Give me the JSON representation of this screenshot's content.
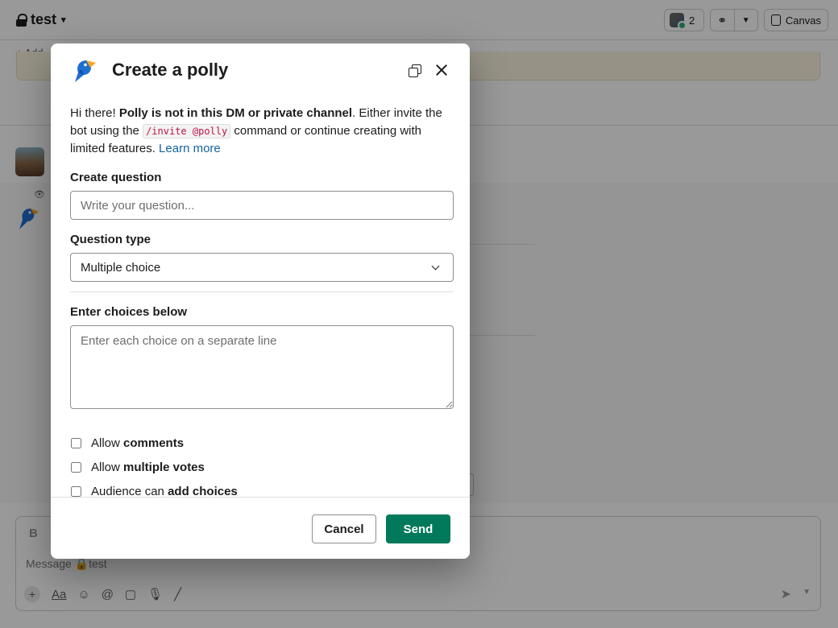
{
  "app": {
    "channel_name": "test",
    "member_count": "2",
    "canvas_label": "Canvas",
    "bookmark_label": "Add",
    "composer_placeholder": "Message 🔒test",
    "composer_bold_label": "B",
    "composer_format_label": "Aa"
  },
  "modal": {
    "title": "Create a polly",
    "intro": {
      "greeting": "Hi there! ",
      "bold_notice": "Polly is not in this DM or private channel",
      "text_before_command": ". Either invite the bot using the ",
      "command": "/invite @polly",
      "text_after_command": " command or continue creating with limited features. ",
      "link_label": "Learn more"
    },
    "question": {
      "label": "Create question",
      "placeholder": "Write your question..."
    },
    "question_type": {
      "label": "Question type",
      "selected": "Multiple choice"
    },
    "choices": {
      "label": "Enter choices below",
      "placeholder": "Enter each choice on a separate line"
    },
    "options": [
      {
        "prefix": "Allow ",
        "bold": "comments",
        "checked": false
      },
      {
        "prefix": "Allow ",
        "bold": "multiple votes",
        "checked": false
      },
      {
        "prefix": "Audience can ",
        "bold": "add choices",
        "checked": false
      }
    ],
    "footer": {
      "cancel_label": "Cancel",
      "send_label": "Send"
    }
  },
  "colors": {
    "send_button": "#007a5a",
    "link": "#1264a3",
    "code_text": "#c01343",
    "polly_blue": "#1f6fd1",
    "polly_orange": "#f5a623"
  }
}
